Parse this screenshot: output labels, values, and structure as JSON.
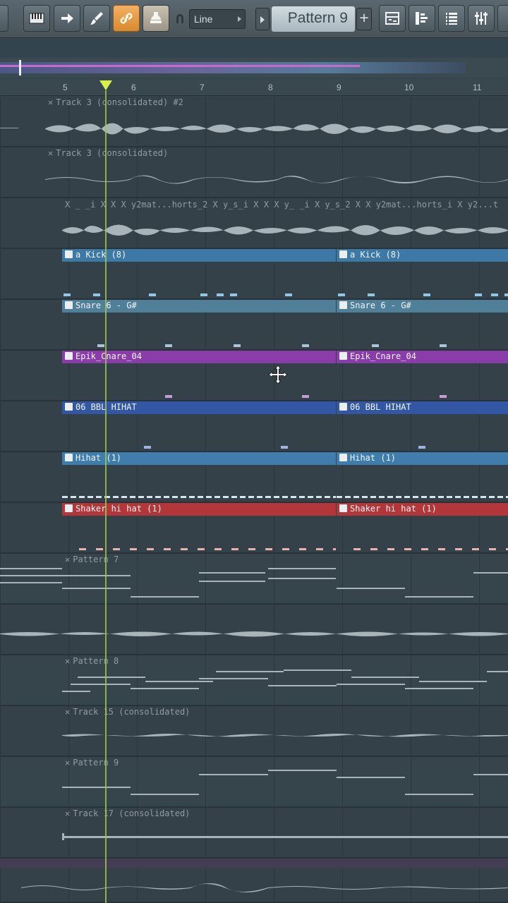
{
  "toolbar": {
    "snap_mode": "Line",
    "pattern_name": "Pattern 9",
    "add_pattern_label": "+"
  },
  "ruler": {
    "bars": [
      "5",
      "6",
      "7",
      "8",
      "9",
      "10",
      "11"
    ]
  },
  "tracks": [
    {
      "type": "audio",
      "clips": [
        {
          "label": "Track 3 (consolidated) #2",
          "style": "ghost"
        }
      ]
    },
    {
      "type": "audio",
      "clips": [
        {
          "label": "Track 3 (consolidated)",
          "style": "ghost"
        }
      ]
    },
    {
      "type": "audio",
      "clips": [
        {
          "label": "X _ _i X X X y2mat...horts_2 X y_s_i X X X y_ _i X y_s_2 X X y2mat...horts_i X y2...t",
          "style": "ghost"
        }
      ]
    },
    {
      "type": "pattern",
      "color": "#3d79a6",
      "clips": [
        {
          "label": "a Kick (8)"
        },
        {
          "label": "a Kick (8)"
        }
      ]
    },
    {
      "type": "pattern",
      "color": "#4f7f99",
      "clips": [
        {
          "label": "Snare 6 - G#"
        },
        {
          "label": "Snare 6 - G#"
        }
      ]
    },
    {
      "type": "pattern",
      "color": "#8a3ca8",
      "clips": [
        {
          "label": "Epik_Cnare_04"
        },
        {
          "label": "Epik_Cnare_04"
        }
      ]
    },
    {
      "type": "pattern",
      "color": "#3357a4",
      "clips": [
        {
          "label": "06 BBL HIHAT"
        },
        {
          "label": "06 BBL HIHAT"
        }
      ]
    },
    {
      "type": "pattern",
      "color": "#3f7eac",
      "clips": [
        {
          "label": "Hihat (1)"
        },
        {
          "label": "Hihat (1)"
        }
      ]
    },
    {
      "type": "pattern",
      "color": "#b2363a",
      "clips": [
        {
          "label": "Shaker hi hat (1)"
        },
        {
          "label": "Shaker hi hat (1)"
        }
      ]
    },
    {
      "type": "piano",
      "clips": [
        {
          "label": "Pattern 7",
          "style": "ghost"
        }
      ]
    },
    {
      "type": "audio",
      "clips": []
    },
    {
      "type": "piano",
      "clips": [
        {
          "label": "Pattern 8",
          "style": "ghost"
        }
      ]
    },
    {
      "type": "audio",
      "clips": [
        {
          "label": "Track 15 (consolidated)",
          "style": "ghost"
        }
      ]
    },
    {
      "type": "piano",
      "clips": [
        {
          "label": "Pattern 9",
          "style": "ghost"
        }
      ]
    },
    {
      "type": "audio",
      "clips": [
        {
          "label": "Track 17 (consolidated)",
          "style": "ghost"
        }
      ]
    },
    {
      "type": "audio",
      "clips": []
    }
  ],
  "icons": [
    "piano-icon",
    "arrow-right-icon",
    "brush-icon",
    "link-icon",
    "stamp-icon",
    "magnet-icon",
    "playlist-icon",
    "step-sequencer-icon",
    "channel-rack-icon",
    "mixer-icon",
    "move-cursor-icon"
  ],
  "colors": {
    "accent": "#f0a34c",
    "playhead": "#d7f14a",
    "background": "#344148"
  }
}
